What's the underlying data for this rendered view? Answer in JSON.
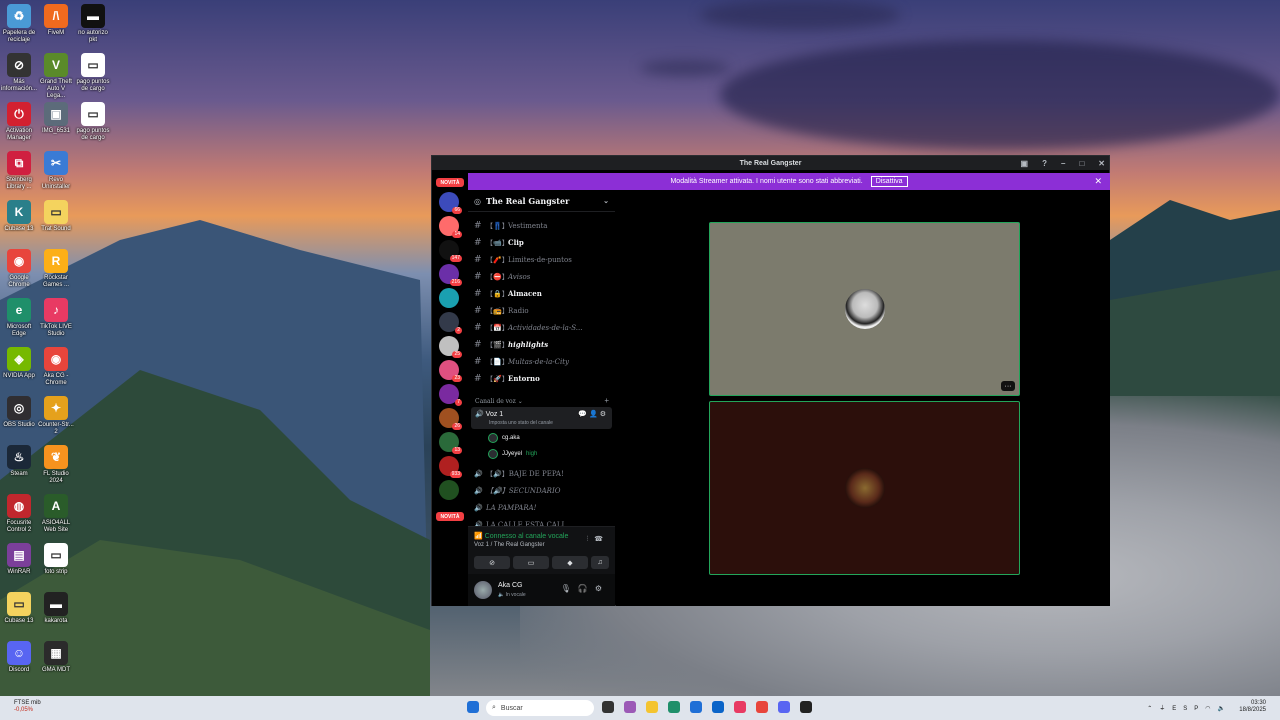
{
  "desktop": {
    "icons": [
      {
        "label": "Papelera de reciclaje",
        "color": "#4a9ad6",
        "glyph": "♻"
      },
      {
        "label": "FiveM",
        "color": "#f06a1e",
        "glyph": "/\\"
      },
      {
        "label": "no autorizo pkt",
        "color": "#111111",
        "glyph": "▬"
      },
      {
        "label": "Más información...",
        "color": "#333333",
        "glyph": "⊘"
      },
      {
        "label": "Grand Theft Auto V Lega...",
        "color": "#5a8a2a",
        "glyph": "V"
      },
      {
        "label": "pago puntos de cargo",
        "color": "#ffffff",
        "glyph": "▭"
      },
      {
        "label": "Activation Manager",
        "color": "#d32030",
        "glyph": "⏻"
      },
      {
        "label": "IMG_6531",
        "color": "#5c6b7a",
        "glyph": "▣"
      },
      {
        "label": "pago puntos de cargo",
        "color": "#ffffff",
        "glyph": "▭"
      },
      {
        "label": "Steinberg Library ...",
        "color": "#d02040",
        "glyph": "⧉"
      },
      {
        "label": "Revo Uninstaller",
        "color": "#3a7bd5",
        "glyph": "✂"
      },
      {
        "label": "Cubase 13",
        "color": "#2a7f8a",
        "glyph": "K"
      },
      {
        "label": "Trat Sound",
        "color": "#f4d35e",
        "glyph": "▭"
      },
      {
        "label": "Google Chrome",
        "color": "#e8453c",
        "glyph": "◉"
      },
      {
        "label": "Rockstar Games ...",
        "color": "#fcaf17",
        "glyph": "R"
      },
      {
        "label": "Microsoft Edge",
        "color": "#1f8f6a",
        "glyph": "e"
      },
      {
        "label": "TikTok LIVE Studio",
        "color": "#e83a63",
        "glyph": "♪"
      },
      {
        "label": "NVIDIA App",
        "color": "#76b900",
        "glyph": "◈"
      },
      {
        "label": "Aka CG - Chrome",
        "color": "#e8453c",
        "glyph": "◉"
      },
      {
        "label": "OBS Studio",
        "color": "#302e31",
        "glyph": "◎"
      },
      {
        "label": "Counter-Str... 2",
        "color": "#e5a11c",
        "glyph": "✦"
      },
      {
        "label": "Steam",
        "color": "#1b2838",
        "glyph": "♨"
      },
      {
        "label": "FL Studio 2024",
        "color": "#f7931e",
        "glyph": "❦"
      },
      {
        "label": "Focusrite Control 2",
        "color": "#c1272d",
        "glyph": "◍"
      },
      {
        "label": "ASIO4ALL Web Site",
        "color": "#2a5c2a",
        "glyph": "A"
      },
      {
        "label": "WinRAR",
        "color": "#7b3f9a",
        "glyph": "▤"
      },
      {
        "label": "foto strip",
        "color": "#ffffff",
        "glyph": "▭"
      },
      {
        "label": "Cubase 13",
        "color": "#f4d35e",
        "glyph": "▭"
      },
      {
        "label": "kakarota",
        "color": "#222222",
        "glyph": "▬"
      },
      {
        "label": "Discord",
        "color": "#5865f2",
        "glyph": "☺"
      },
      {
        "label": "GMA MDT",
        "color": "#2b2b2b",
        "glyph": "▦"
      }
    ]
  },
  "window": {
    "title": "The Real Gangster",
    "streamer_banner": "Modalità Streamer attivata. I nomi utente sono stati abbreviati.",
    "streamer_button": "Disattiva"
  },
  "guilds": {
    "novita_top": "NOVITÀ",
    "novita_bottom": "NOVITÀ",
    "items": [
      {
        "color": "#3c4bbb",
        "badge": "66"
      },
      {
        "color": "#ff6b6b",
        "badge": "14"
      },
      {
        "color": "#111111",
        "badge": "147"
      },
      {
        "color": "#6b2fa8",
        "badge": "216"
      },
      {
        "color": "#1aa0b0",
        "badge": ""
      },
      {
        "color": "#333a4a",
        "badge": "2"
      },
      {
        "color": "#c0c0c0",
        "badge": "25"
      },
      {
        "color": "#e05080",
        "badge": "23"
      },
      {
        "color": "#7a2aa0",
        "badge": "7"
      },
      {
        "color": "#a05020",
        "badge": "26"
      },
      {
        "color": "#2a6a3a",
        "badge": "13"
      },
      {
        "color": "#b02020",
        "badge": "933"
      },
      {
        "color": "#205020",
        "badge": ""
      }
    ]
  },
  "server": {
    "name": "The Real Gangster",
    "text_channels": [
      {
        "emoji": "【👖】",
        "name": "Vestimenta",
        "bold": false,
        "italic": false
      },
      {
        "emoji": "【📹】",
        "name": "Clip",
        "bold": true,
        "italic": false
      },
      {
        "emoji": "【🧨】",
        "name": "Limites-de-puntos",
        "bold": false,
        "italic": false
      },
      {
        "emoji": "【⛔】",
        "name": "Avisos",
        "bold": false,
        "italic": true
      },
      {
        "emoji": "【🔒】",
        "name": "Almacen",
        "bold": true,
        "italic": false
      },
      {
        "emoji": "【📻】",
        "name": "Radio",
        "bold": false,
        "italic": false
      },
      {
        "emoji": "【📅】",
        "name": "Actividades-de-la-S...",
        "bold": false,
        "italic": true
      },
      {
        "emoji": "【🎬】",
        "name": "highlights",
        "bold": true,
        "italic": true
      },
      {
        "emoji": "【📄】",
        "name": "Multas-de-la-City",
        "bold": false,
        "italic": true
      },
      {
        "emoji": "【🚀】",
        "name": "Entorno",
        "bold": true,
        "italic": false
      }
    ],
    "voice_section": "Canali de voz",
    "active_voice": {
      "name": "Voz 1",
      "status": "Imposta uno stato del canale"
    },
    "voice_users": [
      {
        "name": "cg.aka",
        "extra": ""
      },
      {
        "name": "JJyeyel",
        "extra": "high"
      }
    ],
    "other_voice": [
      {
        "name": "【🔊】BAJE DE PEPA!",
        "italic": false
      },
      {
        "name": "【🔊】SECUNDARIO",
        "italic": true
      },
      {
        "name": "LA PAMPARA!",
        "italic": true
      },
      {
        "name": "LA CALLE ESTA CALI...",
        "italic": false
      }
    ]
  },
  "voice_panel": {
    "connected": "Connesso al canale vocale",
    "location": "Voz 1 / The Real Gangster"
  },
  "user_panel": {
    "name": "Aka CG",
    "status": "In vocale"
  },
  "taskbar": {
    "weather_temp": "FTSE mib",
    "weather_change": "-0,05%",
    "search_placeholder": "Buscar",
    "lang": "ESP",
    "time": "03:30",
    "date": "18/8/2025"
  }
}
